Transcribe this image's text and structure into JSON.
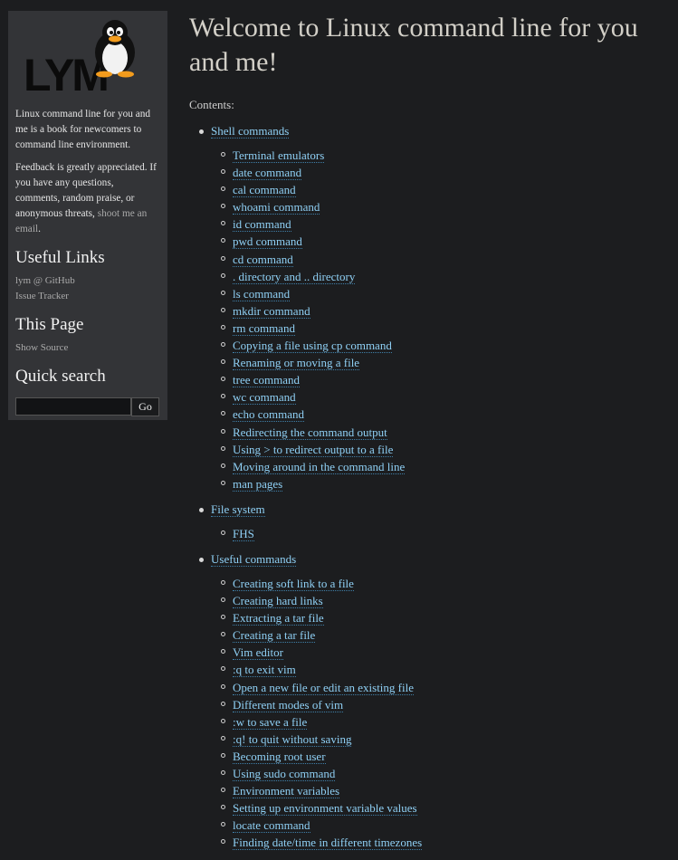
{
  "sidebar": {
    "logo_text": "LYM",
    "description": "Linux command line for you and me is a book for newcomers to command line environment.",
    "feedback_text": "Feedback is greatly appreciated. If you have any questions, comments, random praise, or anonymous threats, ",
    "feedback_link": "shoot me an email",
    "feedback_end": ".",
    "useful_links_heading": "Useful Links",
    "useful_links": [
      "lym @ GitHub",
      "Issue Tracker"
    ],
    "this_page_heading": "This Page",
    "show_source": "Show Source",
    "quick_search_heading": "Quick search",
    "search_value": "",
    "go_label": "Go"
  },
  "main": {
    "title": "Welcome to Linux command line for you and me!",
    "contents_label": "Contents:",
    "toc": [
      {
        "label": "Shell commands",
        "children": [
          "Terminal emulators",
          "date command",
          "cal command",
          "whoami command",
          "id command",
          "pwd command",
          "cd command",
          ". directory and .. directory",
          "ls command",
          "mkdir command",
          "rm command",
          "Copying a file using cp command",
          "Renaming or moving a file",
          "tree command",
          "wc command",
          "echo command",
          "Redirecting the command output",
          "Using > to redirect output to a file",
          "Moving around in the command line",
          "man pages"
        ]
      },
      {
        "label": "File system",
        "children": [
          "FHS"
        ]
      },
      {
        "label": "Useful commands",
        "children": [
          "Creating soft link to a file",
          "Creating hard links",
          "Extracting a tar file",
          "Creating a tar file",
          "Vim editor",
          ":q to exit vim",
          "Open a new file or edit an existing file",
          "Different modes of vim",
          ":w to save a file",
          ":q! to quit without saving",
          "Becoming root user",
          "Using sudo command",
          "Environment variables",
          "Setting up environment variable values",
          "locate command",
          "Finding date/time in different timezones"
        ]
      }
    ]
  },
  "colors": {
    "background": "#1c1d1f",
    "sidebar_bg": "#333437",
    "link": "#8fd0f5"
  }
}
